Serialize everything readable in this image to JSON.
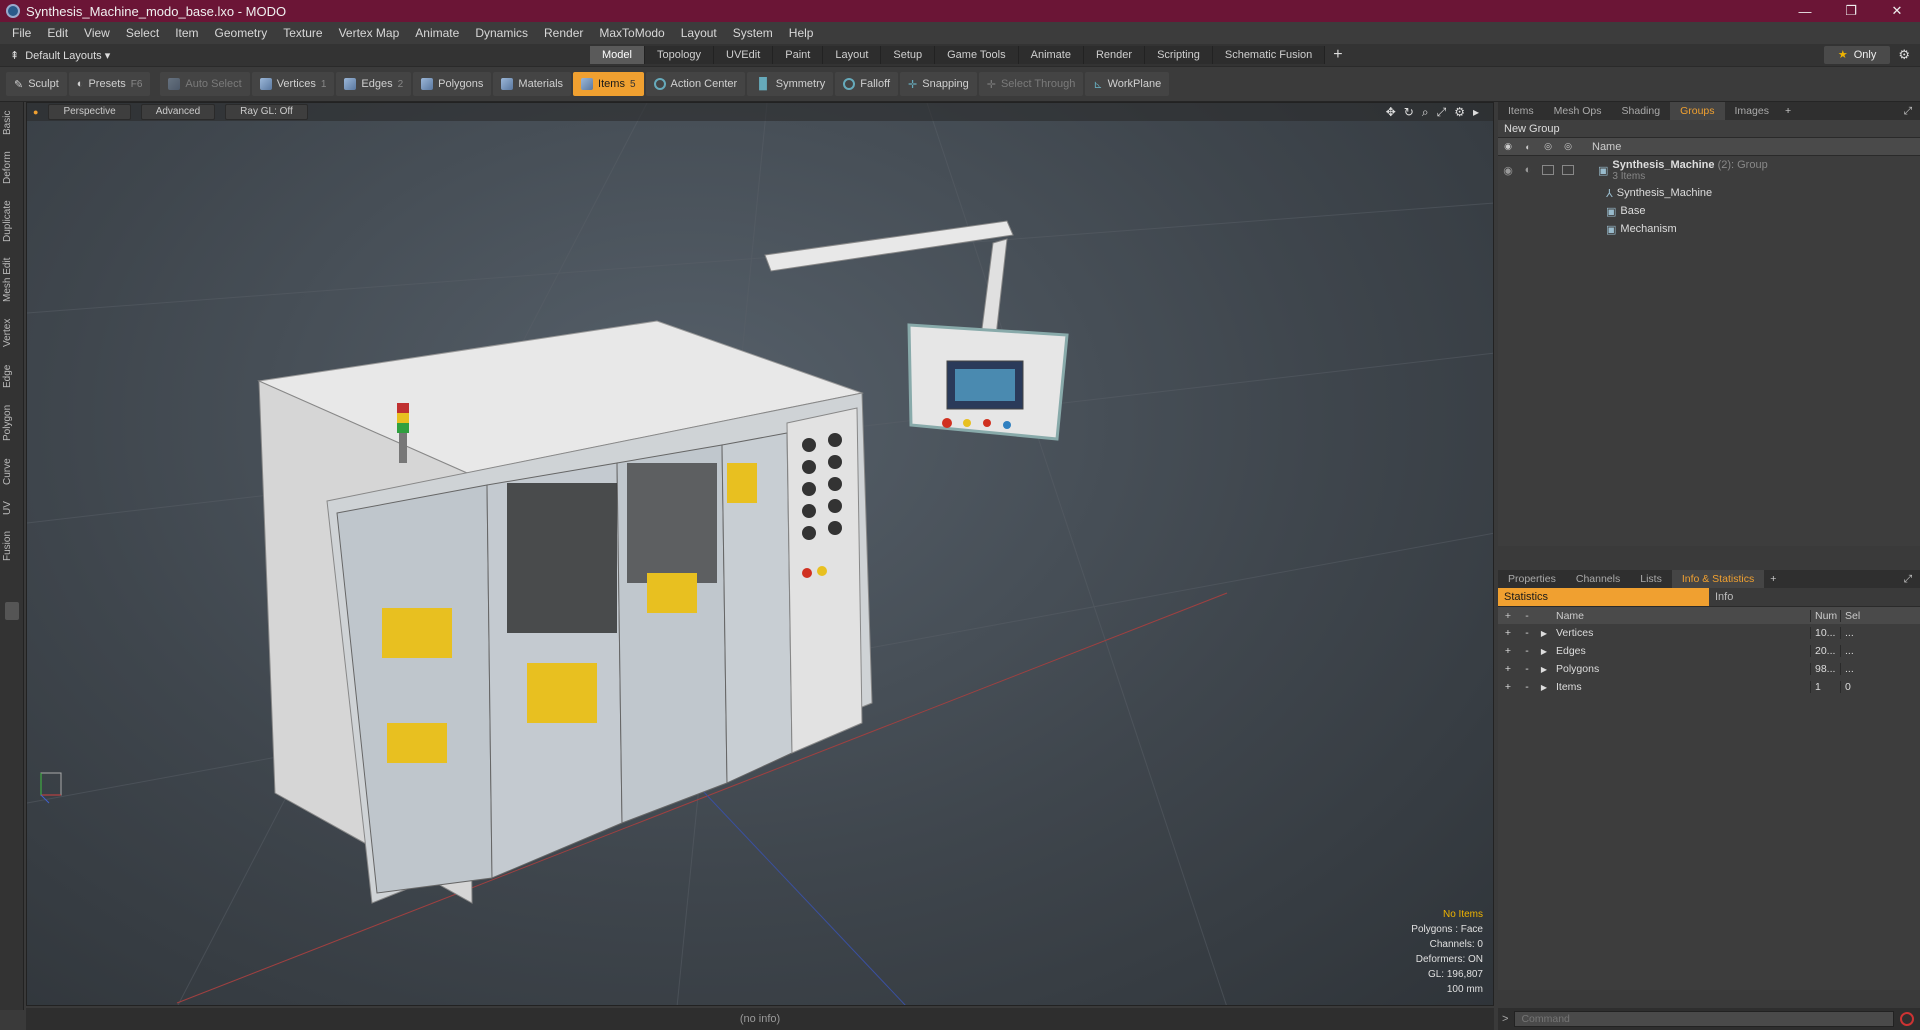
{
  "window": {
    "title": "Synthesis_Machine_modo_base.lxo - MODO",
    "controls": [
      "—",
      "❐",
      "✕"
    ]
  },
  "menu": [
    "File",
    "Edit",
    "View",
    "Select",
    "Item",
    "Geometry",
    "Texture",
    "Vertex Map",
    "Animate",
    "Dynamics",
    "Render",
    "MaxToModo",
    "Layout",
    "System",
    "Help"
  ],
  "layout": {
    "preset": "Default Layouts ▾",
    "tabs": [
      "Model",
      "Topology",
      "UVEdit",
      "Paint",
      "Layout",
      "Setup",
      "Game Tools",
      "Animate",
      "Render",
      "Scripting",
      "Schematic Fusion"
    ],
    "active_tab": "Model",
    "plus": "+",
    "only": "Only"
  },
  "toolbar": {
    "sculpt": "Sculpt",
    "presets": "Presets",
    "presets_key": "F6",
    "auto_select": "Auto Select",
    "vertices": "Vertices",
    "vertices_key": "1",
    "edges": "Edges",
    "edges_key": "2",
    "polygons": "Polygons",
    "materials": "Materials",
    "items": "Items",
    "items_key": "5",
    "action_center": "Action Center",
    "symmetry": "Symmetry",
    "falloff": "Falloff",
    "snapping": "Snapping",
    "select_through": "Select Through",
    "workplane": "WorkPlane"
  },
  "left_tabs": [
    "Basic",
    "Deform",
    "Duplicate",
    "Mesh Edit",
    "Vertex",
    "Edge",
    "Polygon",
    "Curve",
    "UV",
    "Fusion"
  ],
  "viewport": {
    "view": "Perspective",
    "shading": "Advanced",
    "raygl": "Ray GL: Off",
    "info": {
      "no_items": "No Items",
      "polygons": "Polygons : Face",
      "channels": "Channels: 0",
      "deformers": "Deformers: ON",
      "gl": "GL: 196,807",
      "scale": "100 mm"
    }
  },
  "status": "(no info)",
  "groups_panel": {
    "tabs": [
      "Items",
      "Mesh Ops",
      "Shading",
      "Groups",
      "Images"
    ],
    "active_tab": "Groups",
    "new_group": "New Group",
    "col_name": "Name",
    "root": {
      "name": "Synthesis_Machine",
      "count": "(2)",
      "type": ": Group",
      "sub": "3 Items"
    },
    "children": [
      "Synthesis_Machine",
      "Base",
      "Mechanism"
    ]
  },
  "info_panel": {
    "tabs": [
      "Properties",
      "Channels",
      "Lists",
      "Info & Statistics"
    ],
    "active_tab": "Info & Statistics",
    "sub_tabs": [
      "Statistics",
      "Info"
    ],
    "columns": {
      "name": "Name",
      "num": "Num",
      "sel": "Sel"
    },
    "rows": [
      {
        "name": "Vertices",
        "num": "10...",
        "sel": "..."
      },
      {
        "name": "Edges",
        "num": "20...",
        "sel": "..."
      },
      {
        "name": "Polygons",
        "num": "98...",
        "sel": "..."
      },
      {
        "name": "Items",
        "num": "1",
        "sel": "0"
      }
    ]
  },
  "command": {
    "placeholder": "Command"
  },
  "colors": {
    "accent": "#f0a030",
    "titlebar": "#6b1536"
  }
}
